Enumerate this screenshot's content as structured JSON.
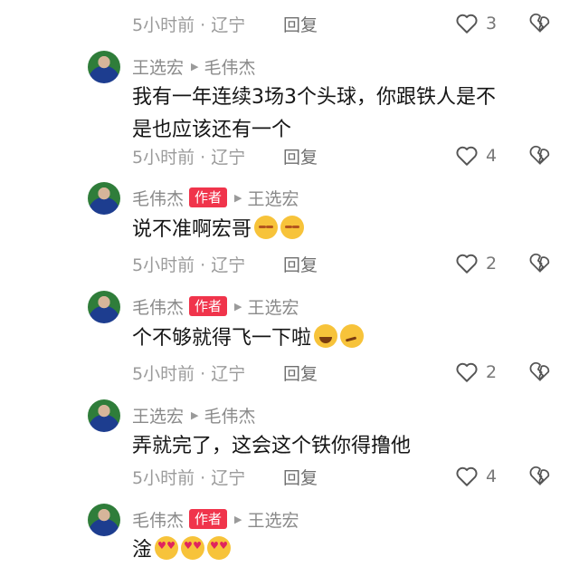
{
  "comments": [
    {
      "meta": "5小时前 · 辽宁",
      "reply": "回复",
      "likes": "3"
    },
    {
      "author": "王选宏",
      "reply_to": "毛伟杰",
      "text_line1": "我有一年连续3场3个头球，你跟铁人是不",
      "text_line2": "是也应该还有一个",
      "meta": "5小时前 · 辽宁",
      "reply": "回复",
      "likes": "4"
    },
    {
      "author": "毛伟杰",
      "badge": "作者",
      "reply_to": "王选宏",
      "text": "说不准啊宏哥",
      "emojis": [
        "shy-face",
        "shy-face"
      ],
      "meta": "5小时前 · 辽宁",
      "reply": "回复",
      "likes": "2"
    },
    {
      "author": "毛伟杰",
      "badge": "作者",
      "reply_to": "王选宏",
      "text": "个不够就得飞一下啦",
      "emojis": [
        "grin-sweat-face",
        "smirk-face"
      ],
      "meta": "5小时前 · 辽宁",
      "reply": "回复",
      "likes": "2"
    },
    {
      "author": "王选宏",
      "reply_to": "毛伟杰",
      "text": "弄就完了，这会这个铁你得撸他",
      "meta": "5小时前 · 辽宁",
      "reply": "回复",
      "likes": "4"
    },
    {
      "author": "毛伟杰",
      "badge": "作者",
      "reply_to": "王选宏",
      "text": "淦",
      "emojis": [
        "heart-eyes-face",
        "heart-eyes-face",
        "heart-eyes-face"
      ]
    }
  ],
  "icons": {
    "like": "heart-outline-icon",
    "dislike": "broken-heart-icon",
    "reply_arrow": "triangle-right-icon"
  },
  "colors": {
    "author_badge": "#f0344b",
    "text": "#161616",
    "meta": "#9b9b9b"
  }
}
